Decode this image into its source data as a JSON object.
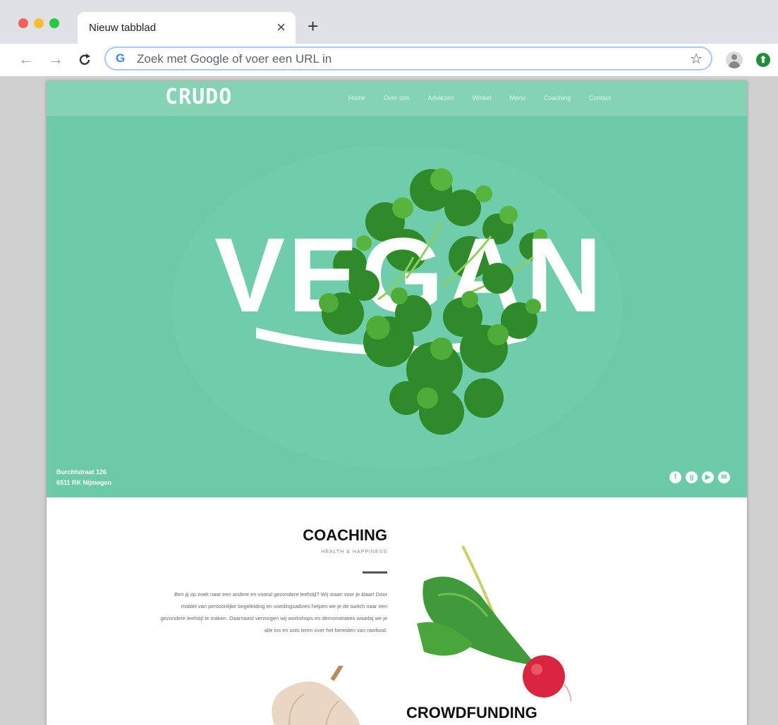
{
  "browser": {
    "tab_title": "Nieuw tabblad",
    "tab_close": "×",
    "new_tab": "+",
    "omnibox_placeholder": "Zoek met Google of voer een URL in",
    "google_letter": "G",
    "back": "←",
    "forward": "→",
    "reload": "C",
    "star": "☆",
    "extension": "⬆",
    "colors": {
      "close": "#ff5f57",
      "minimize": "#febc2e",
      "maximize": "#28c840"
    }
  },
  "site": {
    "logo": "CRUDO",
    "nav": [
      "Home",
      "Over ons",
      "Adviezen",
      "Winkel",
      "Menu",
      "Coaching",
      "Contact"
    ],
    "hero_word": "VEGAN",
    "address_line1": "Burchtstraat 126",
    "address_line2": "6511 RK Nijmegen",
    "socials": [
      {
        "icon": "facebook-icon",
        "glyph": "f"
      },
      {
        "icon": "google-plus-icon",
        "glyph": "g"
      },
      {
        "icon": "youtube-icon",
        "glyph": "▶"
      },
      {
        "icon": "mail-icon",
        "glyph": "✉"
      }
    ],
    "coaching": {
      "title": "COACHING",
      "subtitle": "HEALTH & HAPPINESS",
      "text": "Ben jij op zoek naar een andere en vooral gezondere leefstijl? Wij staan voor je klaar! Door middel van persoonlijke begeleiding en voedingsadvies helpen we je de switch naar een gezondere leefstijl te maken. Daarnaast verzorgen wij workshops en demonstraties waarbij we je alle ins en outs leren over het bereiden van rawfood."
    },
    "crowdfunding": {
      "title": "CROWDFUNDING"
    },
    "colors": {
      "header": "#83d3b4",
      "hero": "#6ccaa8"
    }
  }
}
